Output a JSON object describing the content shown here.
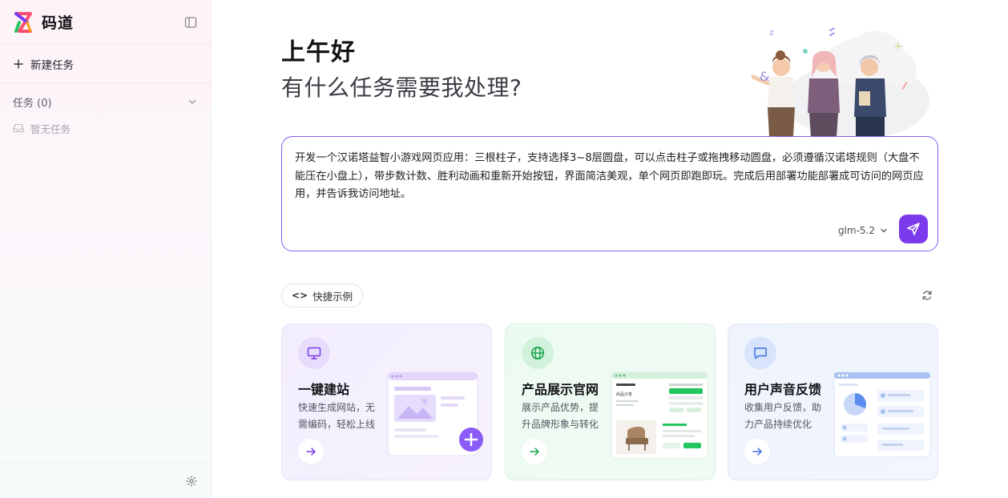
{
  "app": {
    "name": "码道"
  },
  "sidebar": {
    "new_task_label": "新建任务",
    "tasks_label": "任务 (0)",
    "empty_label": "暂无任务"
  },
  "main": {
    "greeting": "上午好",
    "question": "有什么任务需要我处理?",
    "prompt_text": "开发一个汉诺塔益智小游戏网页应用：三根柱子，支持选择3~8层圆盘，可以点击柱子或拖拽移动圆盘，必须遵循汉诺塔规则（大盘不能压在小盘上），带步数计数、胜利动画和重新开始按钮，界面简洁美观，单个网页即跑即玩。完成后用部署功能部署成可访问的网页应用，并告诉我访问地址。",
    "model": "glm-5.2",
    "quick_examples_label": "快捷示例"
  },
  "cards": [
    {
      "title": "一键建站",
      "desc": "快速生成网站，无需编码，轻松上线",
      "icon": "monitor-icon",
      "accent": "#8b5cf6"
    },
    {
      "title": "产品展示官网",
      "desc": "展示产品优势，提升品牌形象与转化",
      "icon": "globe-icon",
      "accent": "#16a34a"
    },
    {
      "title": "用户声音反馈",
      "desc": "收集用户反馈，助力产品持续优化",
      "icon": "chat-icon",
      "accent": "#3b6fe0"
    }
  ],
  "card_art": {
    "mock_title": "尚品沙发"
  },
  "colors": {
    "primary": "#7c3aed",
    "border_accent": "#8b5cf6"
  }
}
